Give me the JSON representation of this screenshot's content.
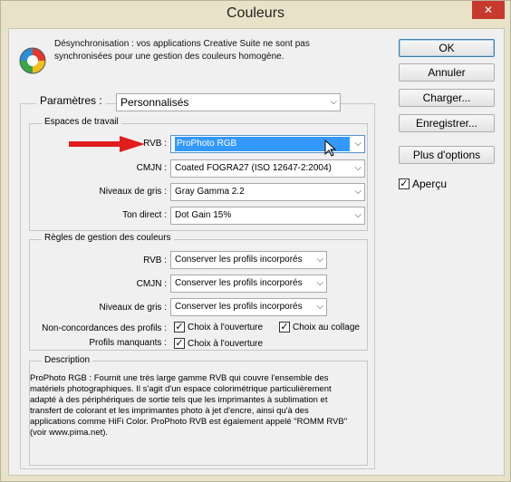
{
  "window": {
    "title": "Couleurs",
    "close_glyph": "✕"
  },
  "sync": {
    "icon": "color-wheel-icon",
    "message": "Désynchronisation : vos applications Creative Suite ne sont pas synchronisées pour une gestion des couleurs homogène."
  },
  "buttons": {
    "ok": "OK",
    "cancel": "Annuler",
    "load": "Charger...",
    "save": "Enregistrer...",
    "more_options": "Plus d'options"
  },
  "preview": {
    "label": "Aperçu",
    "checked": true
  },
  "settings": {
    "label": "Paramètres :",
    "value": "Personnalisés"
  },
  "working_spaces": {
    "title": "Espaces de travail",
    "rows": [
      {
        "label": "RVB :",
        "value": "ProPhoto RGB"
      },
      {
        "label": "CMJN :",
        "value": "Coated FOGRA27 (ISO 12647-2:2004)"
      },
      {
        "label": "Niveaux de gris :",
        "value": "Gray Gamma 2.2"
      },
      {
        "label": "Ton direct :",
        "value": "Dot Gain 15%"
      }
    ]
  },
  "policies": {
    "title": "Règles de gestion des couleurs",
    "rows": [
      {
        "label": "RVB :",
        "value": "Conserver les profils incorporés"
      },
      {
        "label": "CMJN :",
        "value": "Conserver les profils incorporés"
      },
      {
        "label": "Niveaux de gris :",
        "value": "Conserver les profils incorporés"
      }
    ],
    "mismatch_label": "Non-concordances des profils :",
    "mismatch_open": "Choix à l'ouverture",
    "mismatch_paste": "Choix au collage",
    "missing_label": "Profils manquants :",
    "missing_open": "Choix à l'ouverture"
  },
  "description": {
    "title": "Description",
    "text": "ProPhoto RGB : Fournit une très large gamme RVB qui couvre l'ensemble des matériels photographiques. Il s'agit d'un espace colorimétrique particulièrement adapté à des périphériques de sortie tels que les imprimantes à sublimation et transfert de colorant et les imprimantes photo à jet d'encre, ainsi qu'à des applications comme HiFi Color. ProPhoto RVB est également appelé \"ROMM RVB\" (voir www.pima.net)."
  },
  "colors": {
    "accent_red": "#e11d1d",
    "selection": "#3399ff"
  }
}
